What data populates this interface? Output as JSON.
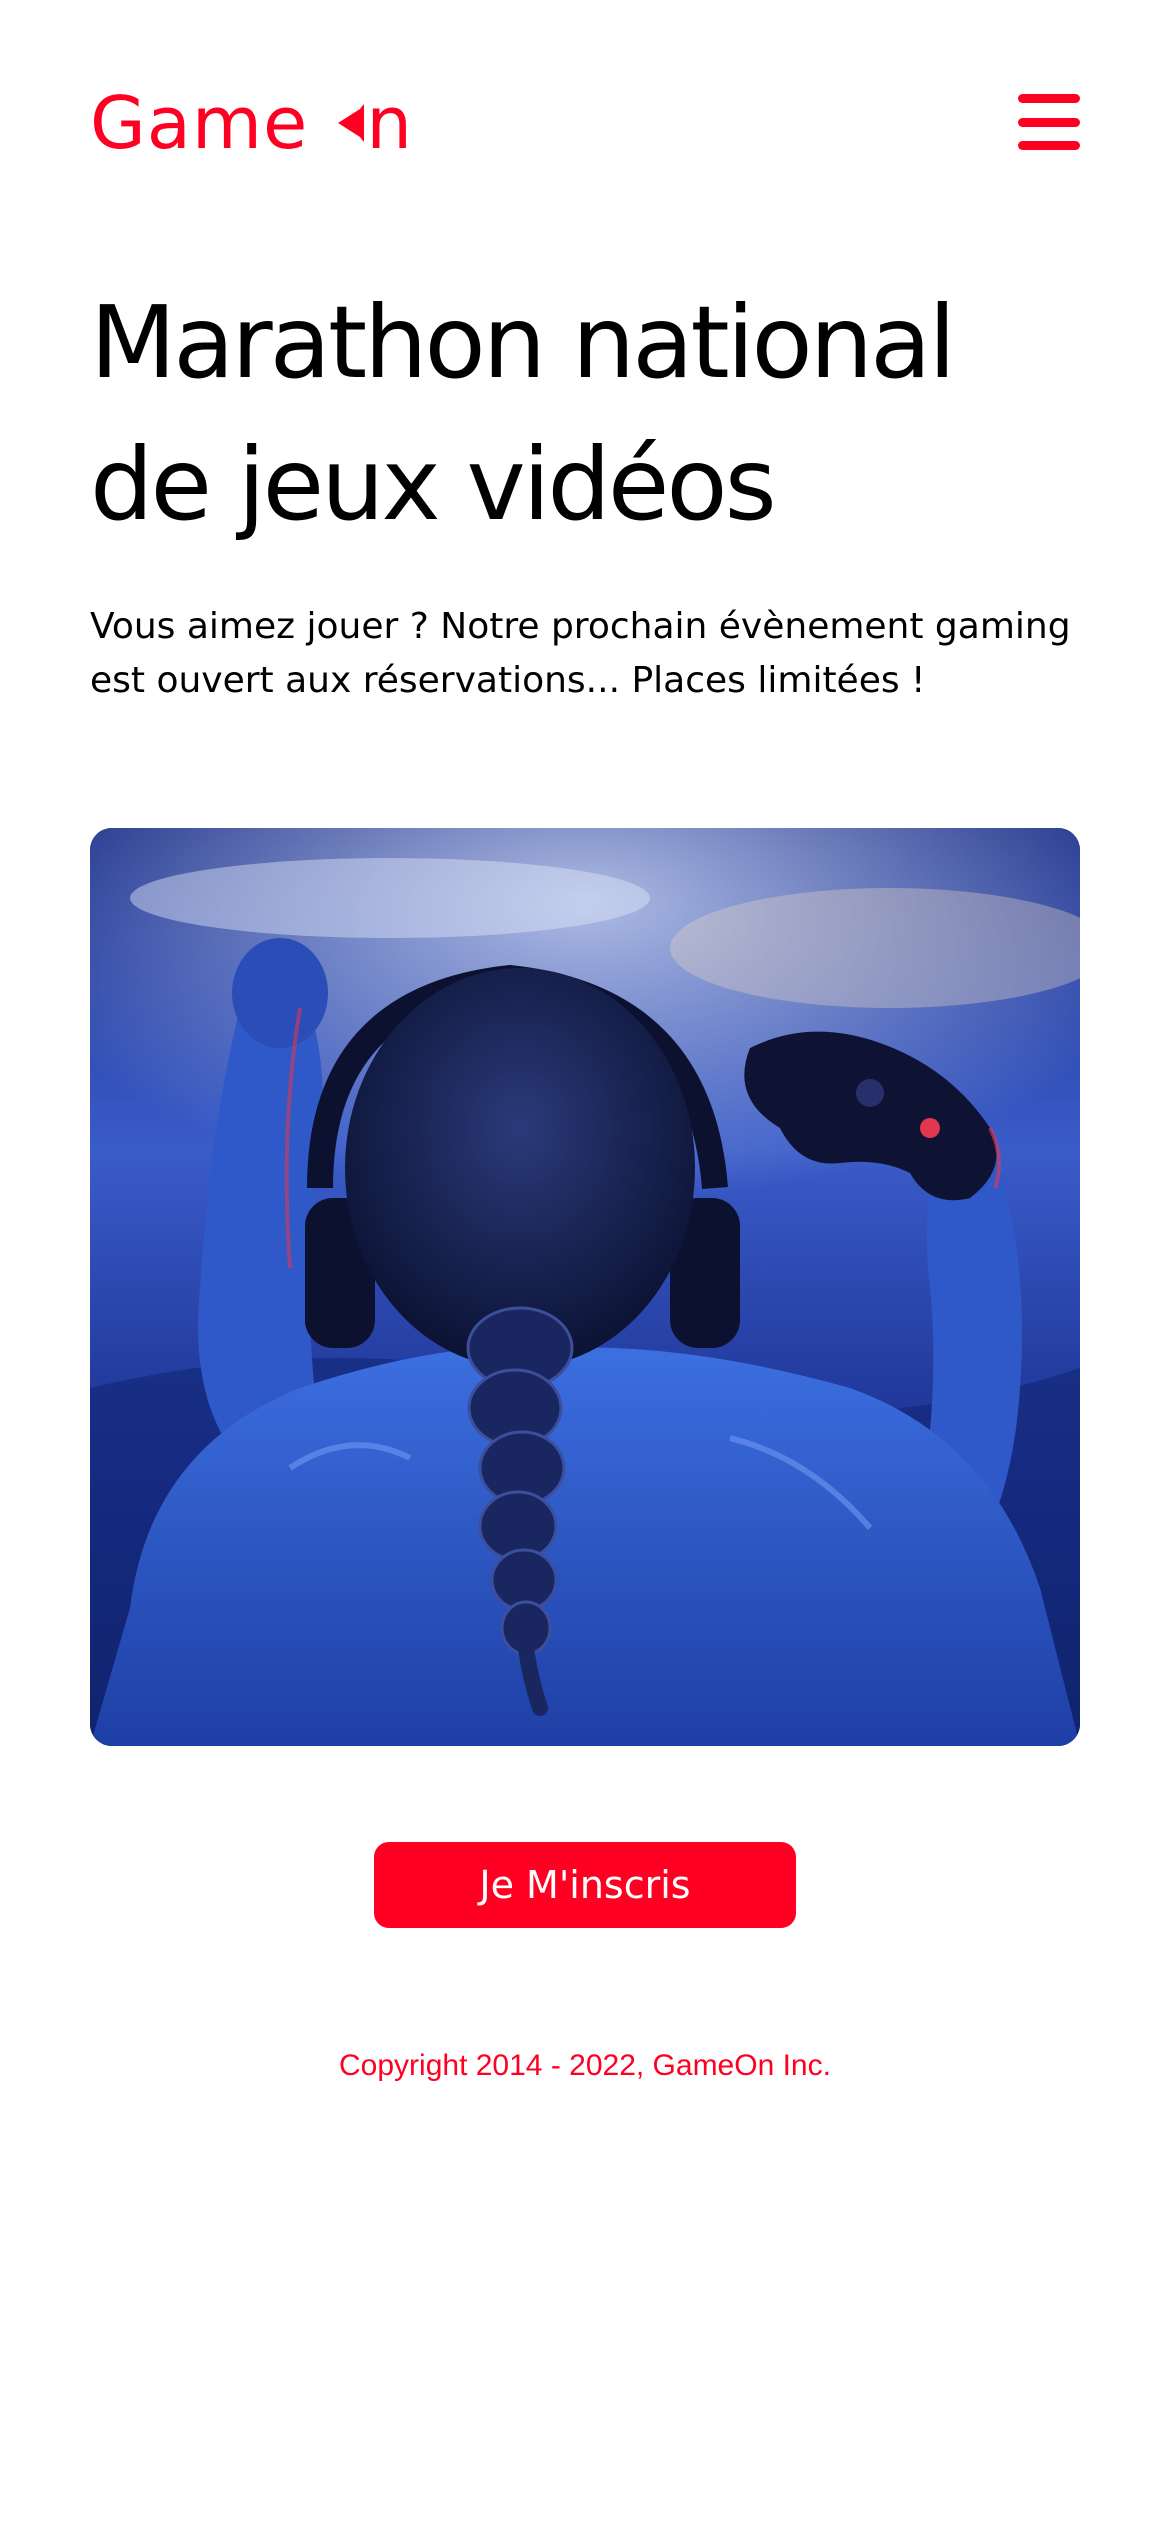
{
  "brand": {
    "name_start": "Game",
    "name_end": "n",
    "logo_icon": "pacman-icon",
    "color": "#FF0022"
  },
  "header": {
    "menu_icon": "hamburger-menu-icon"
  },
  "hero": {
    "title_lines": [
      "Marathon national",
      "de jeux vidéos"
    ],
    "text_lines": [
      "Vous aimez jouer ? Notre prochain évènement gaming",
      "est ouvert aux réservations... Places limitées !"
    ]
  },
  "cta": {
    "label": "Je M'inscris",
    "color": "#FF0022"
  },
  "footer": {
    "copyright": "Copyright 2014 - 2022, GameOn Inc."
  }
}
